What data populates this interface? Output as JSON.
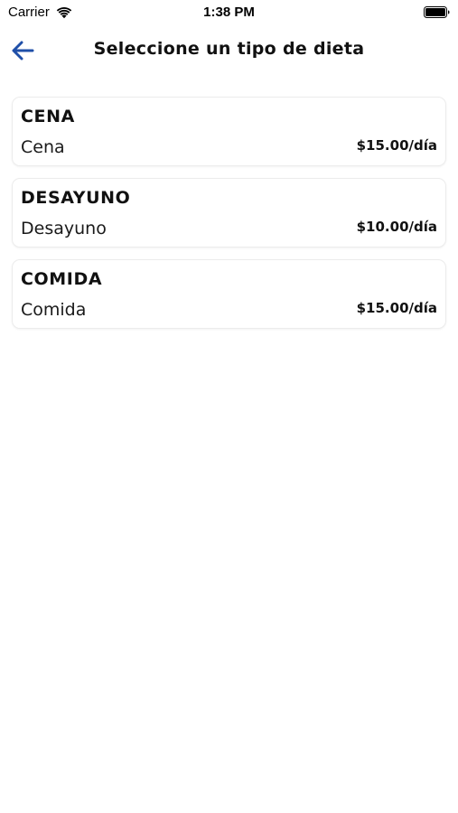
{
  "status_bar": {
    "carrier": "Carrier",
    "time": "1:38 PM"
  },
  "nav": {
    "title": "Seleccione un tipo de dieta",
    "back_icon": "arrow-left-icon",
    "accent_color": "#1f4fa8"
  },
  "diets": [
    {
      "title": "CENA",
      "name": "Cena",
      "price": "$15.00/día"
    },
    {
      "title": "DESAYUNO",
      "name": "Desayuno",
      "price": "$10.00/día"
    },
    {
      "title": "COMIDA",
      "name": "Comida",
      "price": "$15.00/día"
    }
  ]
}
